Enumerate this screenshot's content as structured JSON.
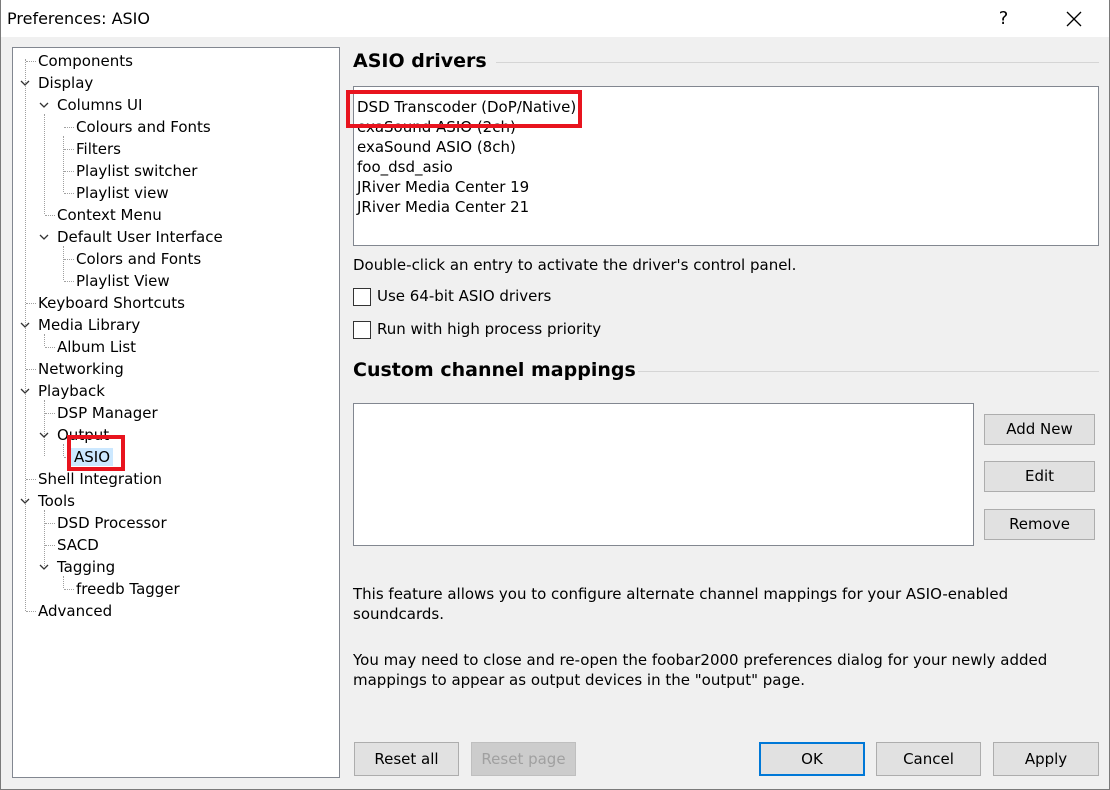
{
  "window": {
    "title": "Preferences: ASIO",
    "help_label": "?"
  },
  "tree": [
    {
      "label": "Components"
    },
    {
      "label": "Display"
    },
    {
      "label": "Columns UI"
    },
    {
      "label": "Colours and Fonts"
    },
    {
      "label": "Filters"
    },
    {
      "label": "Playlist switcher"
    },
    {
      "label": "Playlist view"
    },
    {
      "label": "Context Menu"
    },
    {
      "label": "Default User Interface"
    },
    {
      "label": "Colors and Fonts"
    },
    {
      "label": "Playlist View"
    },
    {
      "label": "Keyboard Shortcuts"
    },
    {
      "label": "Media Library"
    },
    {
      "label": "Album List"
    },
    {
      "label": "Networking"
    },
    {
      "label": "Playback"
    },
    {
      "label": "DSP Manager"
    },
    {
      "label": "Output"
    },
    {
      "label": "ASIO"
    },
    {
      "label": "Shell Integration"
    },
    {
      "label": "Tools"
    },
    {
      "label": "DSD Processor"
    },
    {
      "label": "SACD"
    },
    {
      "label": "Tagging"
    },
    {
      "label": "freedb Tagger"
    },
    {
      "label": "Advanced"
    }
  ],
  "asio": {
    "section_title": "ASIO drivers",
    "drivers": [
      "DSD Transcoder (DoP/Native)",
      "exaSound ASIO (2ch)",
      "exaSound ASIO (8ch)",
      "foo_dsd_asio",
      "JRiver Media Center 19",
      "JRiver Media Center 21"
    ],
    "hint": "Double-click an entry to activate the driver's control panel.",
    "use_64bit_label": "Use 64-bit ASIO drivers",
    "high_priority_label": "Run with high process priority"
  },
  "mappings": {
    "section_title": "Custom channel mappings",
    "add_new_label": "Add New",
    "edit_label": "Edit",
    "remove_label": "Remove",
    "description": "This feature allows you to configure alternate channel mappings for your ASIO-enabled soundcards.",
    "note": "You may need to close and re-open the foobar2000 preferences dialog for your newly added mappings to appear as output devices in the \"output\" page."
  },
  "footer": {
    "reset_all_label": "Reset all",
    "reset_page_label": "Reset page",
    "ok_label": "OK",
    "cancel_label": "Cancel",
    "apply_label": "Apply"
  },
  "colors": {
    "highlight": "#e8141e",
    "selection": "#cce8ff",
    "default_button_border": "#0078d7"
  }
}
